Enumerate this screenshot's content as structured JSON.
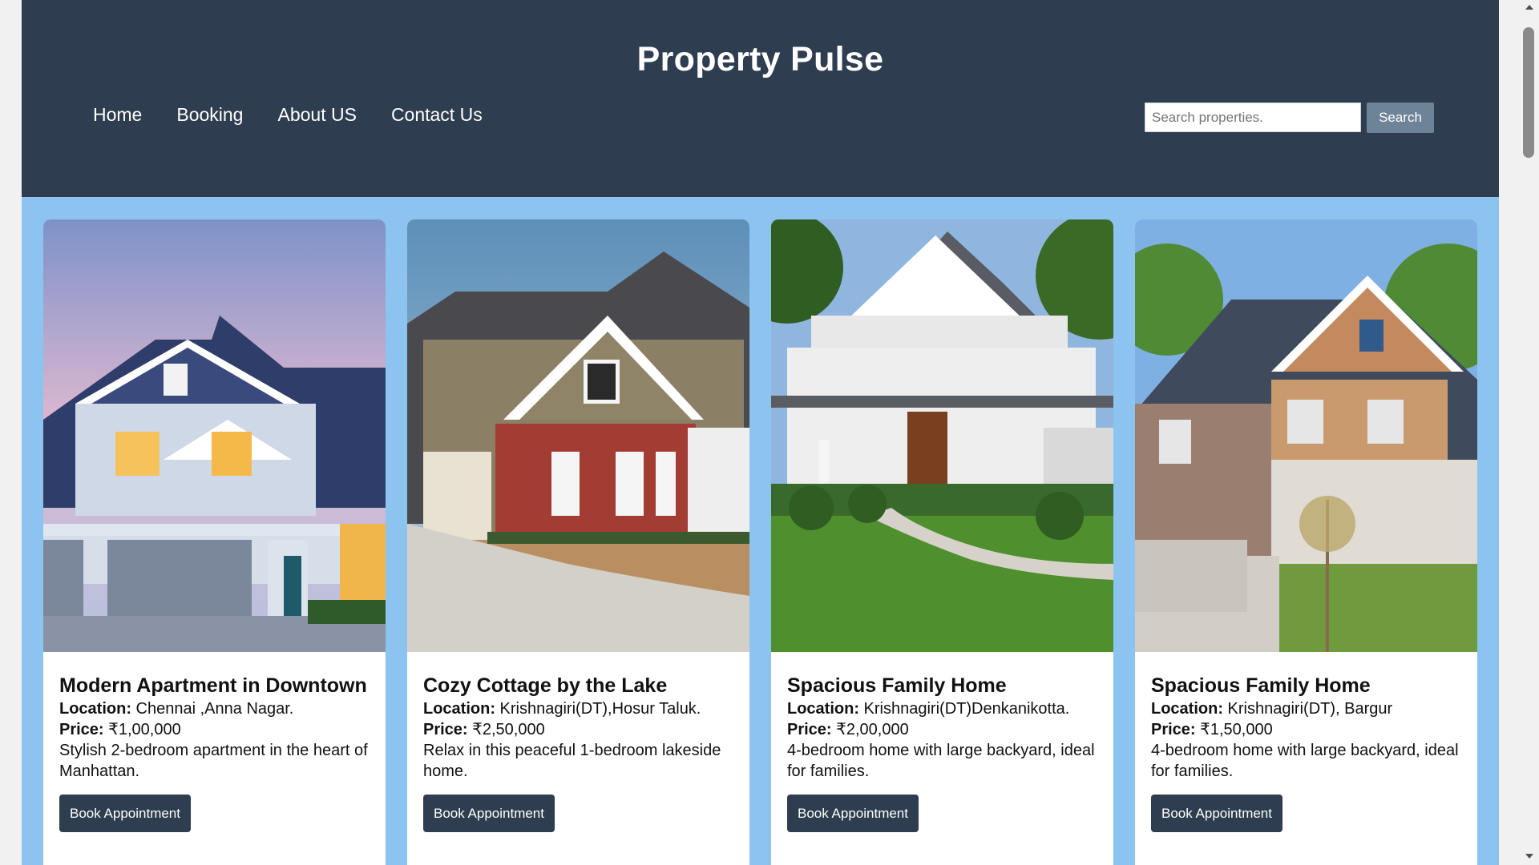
{
  "header": {
    "brand": "Property Pulse",
    "nav": [
      "Home",
      "Booking",
      "About US",
      "Contact Us"
    ],
    "search": {
      "placeholder": "Search properties.",
      "value": "",
      "button_label": "Search"
    }
  },
  "colors": {
    "header_bg": "#2e3d4f",
    "page_bg": "#8cc4ef",
    "card_bg": "#ffffff",
    "button_bg": "#2e3d4f",
    "search_button_bg": "#6d8397"
  },
  "labels": {
    "location": "Location:",
    "price": "Price:"
  },
  "properties": [
    {
      "title": "Modern Apartment in Downtown",
      "location": " Chennai ,Anna Nagar.",
      "price": " ₹1,00,000",
      "description": "Stylish 2-bedroom apartment in the heart of Manhattan.",
      "button_label": "Book Appointment"
    },
    {
      "title": "Cozy Cottage by the Lake",
      "location": " Krishnagiri(DT),Hosur Taluk.",
      "price": " ₹2,50,000",
      "description": "Relax in this peaceful 1-bedroom lakeside home.",
      "button_label": "Book Appointment"
    },
    {
      "title": "Spacious Family Home",
      "location": " Krishnagiri(DT)Denkanikotta.",
      "price": " ₹2,00,000",
      "description": "4-bedroom home with large backyard, ideal for families.",
      "button_label": "Book Appointment"
    },
    {
      "title": "Spacious Family Home",
      "location": " Krishnagiri(DT), Bargur",
      "price": " ₹1,50,000",
      "description": "4-bedroom home with large backyard, ideal for families.",
      "button_label": "Book Appointment"
    }
  ]
}
